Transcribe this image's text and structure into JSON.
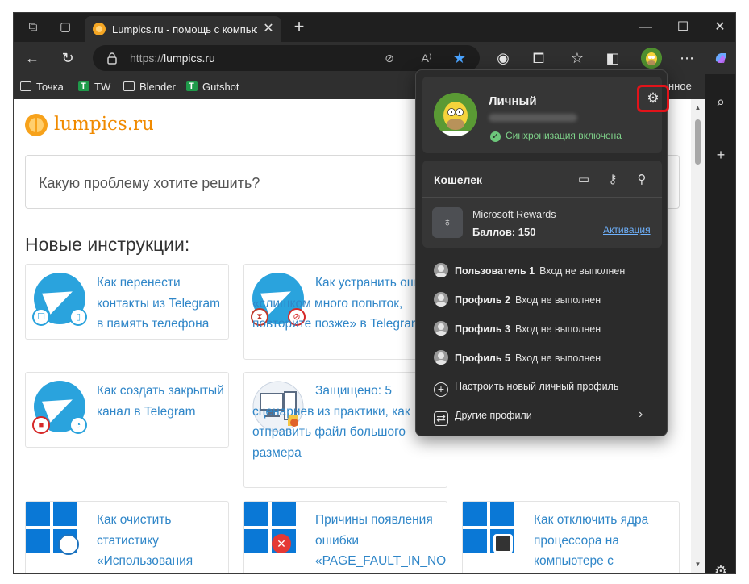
{
  "tab": {
    "title": "Lumpics.ru - помощь с компьютером",
    "close": "✕"
  },
  "window_controls": {
    "minimize": "—",
    "maximize": "☐",
    "close": "✕"
  },
  "new_tab": "+",
  "address_bar": {
    "scheme": "https://",
    "host": "lumpics.ru",
    "read_aloud": "A⁾"
  },
  "bookmarks": [
    {
      "label": "Точка",
      "icon": "folder-icon"
    },
    {
      "label": "TW",
      "icon": "green-bookmark-icon"
    },
    {
      "label": "Blender",
      "icon": "folder-icon"
    },
    {
      "label": "Gutshot",
      "icon": "green-bookmark-icon"
    }
  ],
  "bookmarks_overflow": "нное",
  "page": {
    "logo_text": "lumpics.ru",
    "search_placeholder": "Какую проблему хотите решить?",
    "section_title": "Новые инструкции:",
    "cards": [
      {
        "text": "Как перенести контакты из Telegram в память телефона",
        "icon": "telegram-icon"
      },
      {
        "text": "Как устранить ошибку «слишком много попыток, повторите позже» в Telegram",
        "icon": "telegram-icon"
      },
      {
        "text": "Как создать закрытый канал в Telegram",
        "icon": "telegram-icon"
      },
      {
        "text": "Защищено: 5 сценариев из практики, как отправить файл большого размера",
        "icon": "computer-icon"
      },
      {
        "text": "Как очистить статистику «Использования",
        "icon": "windows-icon"
      },
      {
        "text": "Причины появления ошибки «PAGE_FAULT_IN_NO",
        "icon": "windows-icon"
      },
      {
        "text": "Как отключить ядра процессора на компьютере с",
        "icon": "windows-icon"
      }
    ]
  },
  "profile_flyout": {
    "name": "Личный",
    "sync_status": "Синхронизация включена",
    "wallet": {
      "title": "Кошелек",
      "rewards_name": "Microsoft Rewards",
      "points": "Баллов: 150",
      "activate_link": "Активация"
    },
    "profiles": [
      {
        "name": "Пользователь 1",
        "status": "Вход не выполнен"
      },
      {
        "name": "Профиль 2",
        "status": "Вход не выполнен"
      },
      {
        "name": "Профиль 3",
        "status": "Вход не выполнен"
      },
      {
        "name": "Профиль 5",
        "status": "Вход не выполнен"
      }
    ],
    "add_profile": "Настроить новый личный профиль",
    "other_profiles": "Другие профили"
  },
  "colors": {
    "accent_link": "#2f86c8",
    "logo_orange": "#f08a00",
    "highlight_red": "#e2131a",
    "sync_green": "#7fd38a",
    "browser_dark": "#2f2f2f"
  }
}
